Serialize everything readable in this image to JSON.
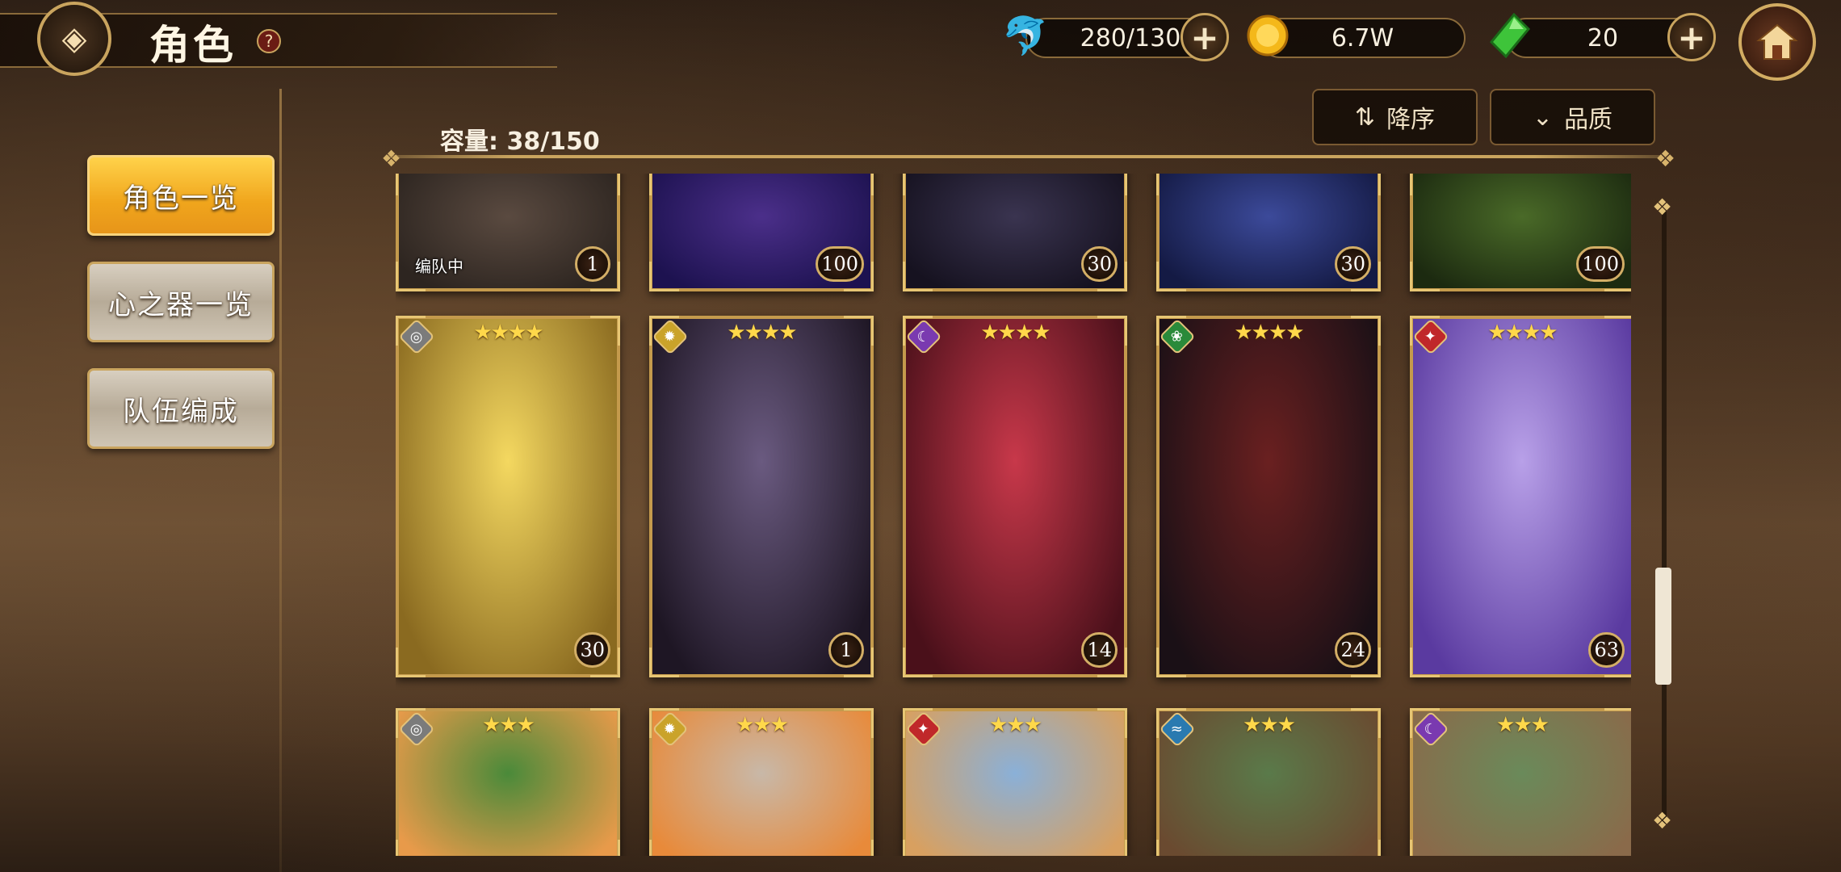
{
  "header": {
    "title": "角色",
    "help": "?",
    "stamina": "280/130",
    "gold": "6.7W",
    "gems": "20"
  },
  "menu": [
    {
      "label": "角色一览",
      "active": true
    },
    {
      "label": "心之器一览",
      "active": false
    },
    {
      "label": "队伍编成",
      "active": false
    }
  ],
  "capacity": "容量: 38/150",
  "sort": {
    "order_label": "降序",
    "filter_label": "品质"
  },
  "rows": [
    {
      "partial": true,
      "cards": [
        {
          "level": "1",
          "stars": "",
          "tag": "编队中",
          "colors": [
            "#5a4a40",
            "#2d2520"
          ]
        },
        {
          "level": "100",
          "stars": "",
          "tag": "",
          "colors": [
            "#4b2f8a",
            "#1d1250"
          ]
        },
        {
          "level": "30",
          "stars": "",
          "tag": "",
          "colors": [
            "#3a3450",
            "#161220"
          ]
        },
        {
          "level": "30",
          "stars": "",
          "tag": "",
          "colors": [
            "#3c4a9a",
            "#141a44"
          ]
        },
        {
          "level": "100",
          "stars": "",
          "tag": "",
          "colors": [
            "#4a6a28",
            "#1c2a10"
          ]
        }
      ]
    },
    {
      "partial": false,
      "cards": [
        {
          "level": "30",
          "stars": "★★★★",
          "tag": "",
          "attr_color": "#7b7b7b",
          "attr_glyph": "◎",
          "colors": [
            "#f4d860",
            "#8a6a20"
          ]
        },
        {
          "level": "1",
          "stars": "★★★★",
          "tag": "",
          "attr_color": "#caa32a",
          "attr_glyph": "✹",
          "colors": [
            "#6a5a80",
            "#1e1624"
          ]
        },
        {
          "level": "14",
          "stars": "★★★★",
          "tag": "",
          "attr_color": "#7a3ab0",
          "attr_glyph": "☾",
          "colors": [
            "#c8384a",
            "#4a101a"
          ]
        },
        {
          "level": "24",
          "stars": "★★★★",
          "tag": "",
          "attr_color": "#2a8a3a",
          "attr_glyph": "❀",
          "colors": [
            "#6a2020",
            "#1a1016"
          ]
        },
        {
          "level": "63",
          "stars": "★★★★",
          "tag": "",
          "attr_color": "#c0282a",
          "attr_glyph": "✦",
          "colors": [
            "#b8a0e8",
            "#5a3aa0"
          ]
        }
      ]
    },
    {
      "partial": true,
      "cards": [
        {
          "level": "",
          "stars": "★★★",
          "tag": "",
          "attr_color": "#7b7b7b",
          "attr_glyph": "◎",
          "colors": [
            "#4a8a3a",
            "#e89a4a"
          ]
        },
        {
          "level": "",
          "stars": "★★★",
          "tag": "",
          "attr_color": "#caa32a",
          "attr_glyph": "✹",
          "colors": [
            "#c8b8a8",
            "#e88a3a"
          ]
        },
        {
          "level": "",
          "stars": "★★★",
          "tag": "",
          "attr_color": "#c0282a",
          "attr_glyph": "✦",
          "colors": [
            "#8ab0d8",
            "#d8a060"
          ]
        },
        {
          "level": "",
          "stars": "★★★",
          "tag": "",
          "attr_color": "#2a7ab0",
          "attr_glyph": "≈",
          "colors": [
            "#5a7a4a",
            "#6a4a30"
          ]
        },
        {
          "level": "",
          "stars": "★★★",
          "tag": "",
          "attr_color": "#7a3ab0",
          "attr_glyph": "☾",
          "colors": [
            "#6a8a5a",
            "#8a6a4a"
          ]
        }
      ]
    }
  ]
}
